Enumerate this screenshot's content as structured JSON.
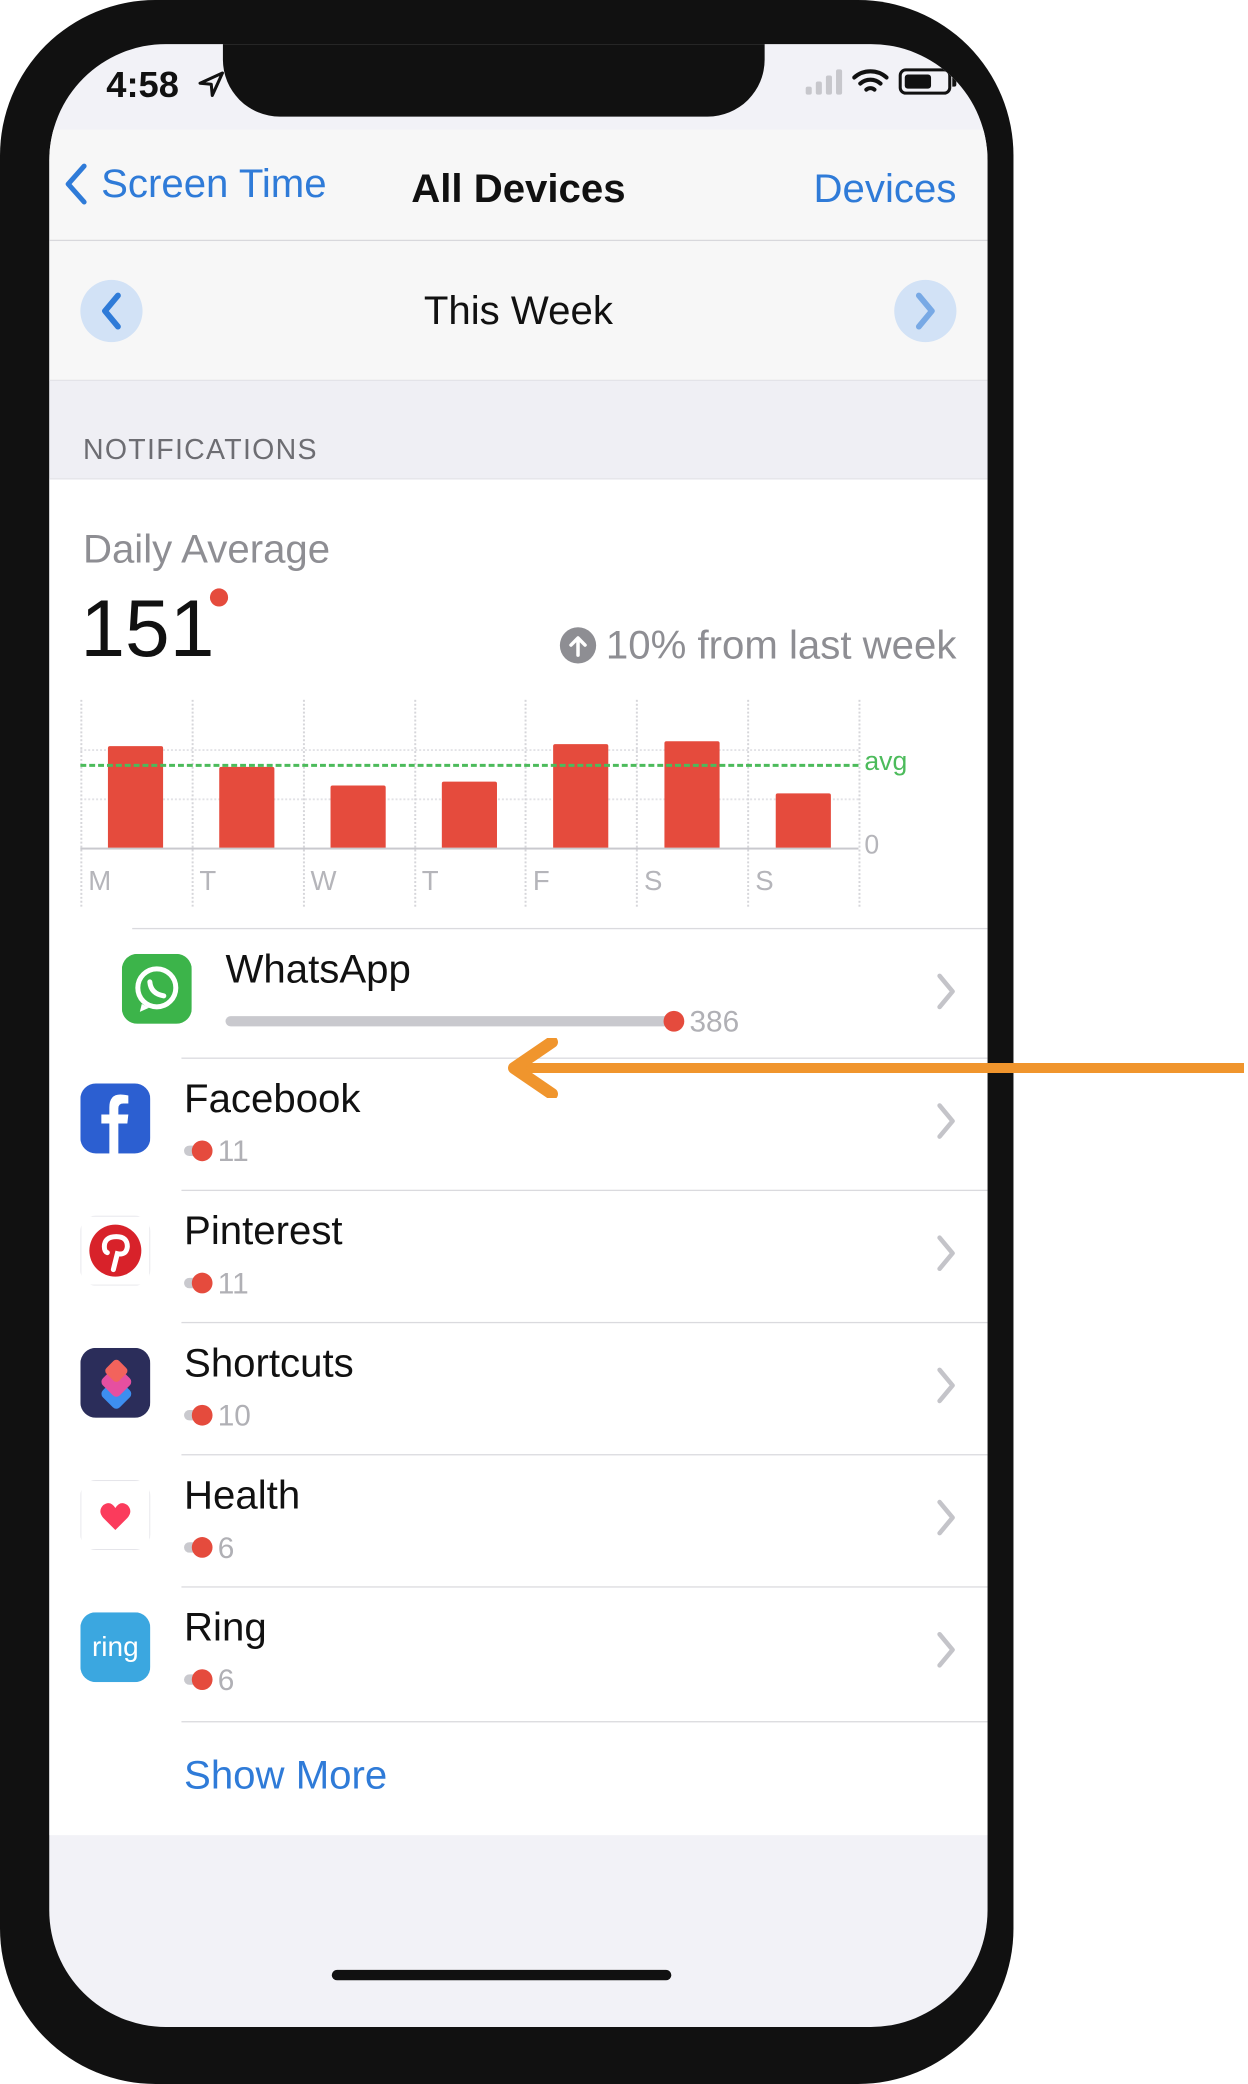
{
  "status_bar": {
    "time": "4:58"
  },
  "nav": {
    "back_label": "Screen Time",
    "title": "All Devices",
    "right_label": "Devices"
  },
  "period": {
    "label": "This Week"
  },
  "section": {
    "header": "NOTIFICATIONS"
  },
  "summary": {
    "label": "Daily Average",
    "value": "151",
    "change_text": "10% from last week",
    "change_direction": "up"
  },
  "chart_data": {
    "type": "bar",
    "categories": [
      "M",
      "T",
      "W",
      "T",
      "F",
      "S",
      "S"
    ],
    "values": [
      206,
      165,
      126,
      134,
      211,
      216,
      111
    ],
    "avg_label": "avg",
    "avg_value": 170,
    "zero_label": "0",
    "ylim": [
      0,
      300
    ],
    "color": "#e54b3d",
    "avg_color": "#4cbb5b"
  },
  "apps": [
    {
      "name": "WhatsApp",
      "count": "386",
      "fraction": 1.0,
      "icon": "whatsapp-icon",
      "color": "#3cb44a"
    },
    {
      "name": "Facebook",
      "count": "11",
      "fraction": 0.03,
      "icon": "facebook-icon",
      "color": "#2c5fd1"
    },
    {
      "name": "Pinterest",
      "count": "11",
      "fraction": 0.03,
      "icon": "pinterest-icon",
      "color": "#d8222a"
    },
    {
      "name": "Shortcuts",
      "count": "10",
      "fraction": 0.03,
      "icon": "shortcuts-icon",
      "color": "#2b2d5a"
    },
    {
      "name": "Health",
      "count": "6",
      "fraction": 0.02,
      "icon": "health-icon",
      "color": "#fb3b5c"
    },
    {
      "name": "Ring",
      "count": "6",
      "fraction": 0.02,
      "icon": "ring-icon",
      "color": "#3ba7e0"
    }
  ],
  "show_more": "Show More",
  "accent_color": "#2f7bd8",
  "annotation_arrow_color": "#f0952d"
}
